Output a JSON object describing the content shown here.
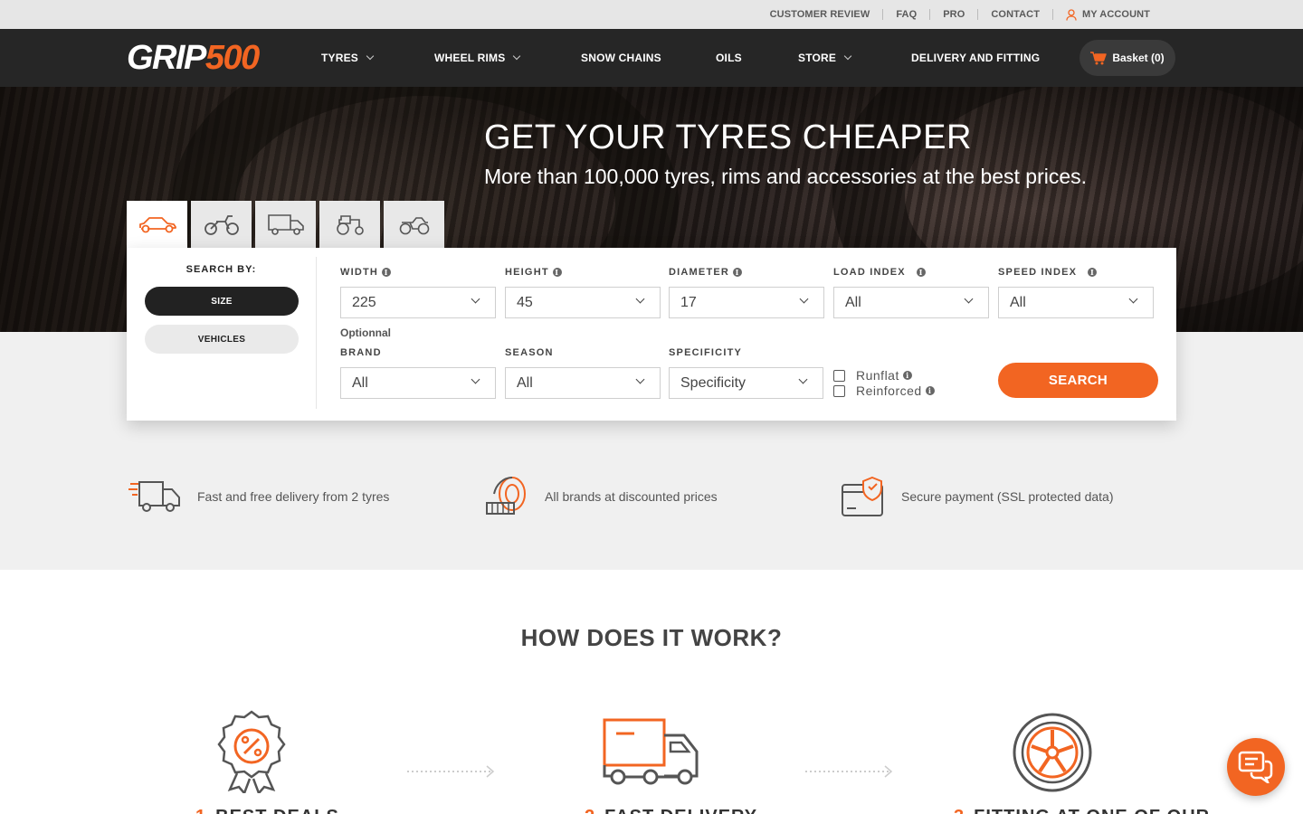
{
  "topbar": {
    "links": [
      "CUSTOMER REVIEW",
      "FAQ",
      "PRO",
      "CONTACT"
    ],
    "account": "MY ACCOUNT"
  },
  "nav": {
    "logo_white": "GRIP",
    "logo_orange": "500",
    "items": [
      "TYRES",
      "WHEEL RIMS",
      "SNOW CHAINS",
      "OILS",
      "STORE",
      "DELIVERY AND FITTING"
    ],
    "basket": "Basket (0)"
  },
  "hero": {
    "title": "GET YOUR TYRES CHEAPER",
    "subtitle": "More than 100,000 tyres, rims and accessories at the best prices."
  },
  "vehicle_tabs": [
    "car-icon",
    "motorcycle-icon",
    "van-icon",
    "tractor-icon",
    "quad-icon"
  ],
  "search": {
    "search_by": "SEARCH BY:",
    "mode_size": "SIZE",
    "mode_vehicles": "VEHICLES",
    "width_label": "WIDTH",
    "width_value": "225",
    "height_label": "HEIGHT",
    "height_value": "45",
    "diameter_label": "DIAMETER",
    "diameter_value": "17",
    "load_label": "LOAD INDEX",
    "load_value": "All",
    "speed_label": "SPEED INDEX",
    "speed_value": "All",
    "optional": "Optionnal",
    "brand_label": "BRAND",
    "brand_value": "All",
    "season_label": "SEASON",
    "season_value": "All",
    "specificity_label": "SPECIFICITY",
    "specificity_value": "Specificity",
    "runflat": "Runflat",
    "reinforced": "Reinforced",
    "button": "SEARCH"
  },
  "features": [
    "Fast and free delivery from 2 tyres",
    "All brands at discounted prices",
    "Secure payment (SSL protected data)"
  ],
  "how": {
    "title": "HOW DOES IT WORK?",
    "steps": [
      {
        "num": "1",
        "title": "BEST DEALS"
      },
      {
        "num": "2",
        "title": "FAST DELIVERY"
      },
      {
        "num": "3",
        "title": "FITTING AT ONE OF OUR"
      }
    ]
  },
  "colors": {
    "accent": "#f26522",
    "dark": "#262626"
  }
}
